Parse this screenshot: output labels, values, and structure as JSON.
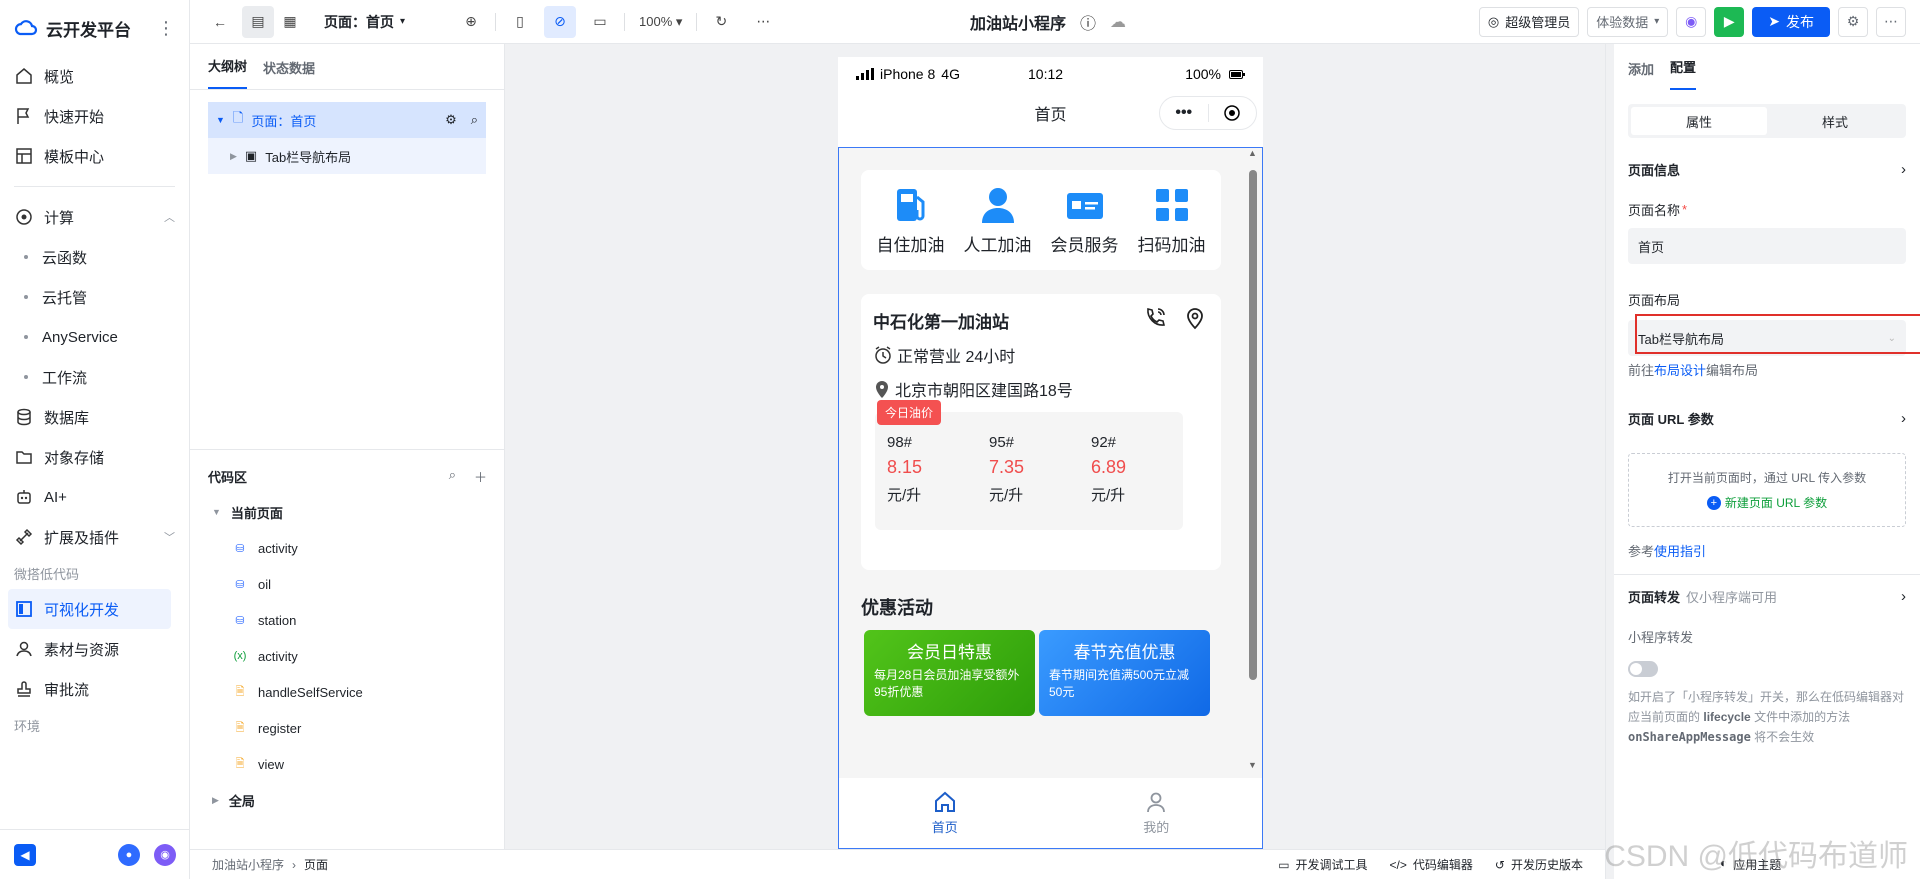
{
  "brand": {
    "name": "云开发平台"
  },
  "nav": {
    "overview": "概览",
    "quickstart": "快速开始",
    "templates": "模板中心",
    "compute": "计算",
    "functions": "云函数",
    "hosting": "云托管",
    "anyservice": "AnyService",
    "workflow": "工作流",
    "database": "数据库",
    "storage": "对象存储",
    "ai": "AI+",
    "extensions": "扩展及插件",
    "lowcode_group": "微搭低代码",
    "visual_dev": "可视化开发",
    "assets": "素材与资源",
    "approval": "审批流",
    "env_group": "环境"
  },
  "toolbar": {
    "page_selector": "页面：首页",
    "zoom": "100%",
    "app_title": "加油站小程序",
    "admin": "超级管理员",
    "data_mode": "体验数据",
    "publish": "发布"
  },
  "outline": {
    "tab_tree": "大纲树",
    "tab_state": "状态数据",
    "page_node": "页面：首页",
    "child_node": "Tab栏导航布局"
  },
  "code": {
    "title": "代码区",
    "current_page": "当前页面",
    "items": [
      "activity",
      "oil",
      "station",
      "activity",
      "handleSelfService",
      "register",
      "view"
    ],
    "global": "全局"
  },
  "phone": {
    "carrier": "iPhone 8",
    "network": "4G",
    "time": "10:12",
    "battery": "100%",
    "nav_title": "首页",
    "services": [
      "自住加油",
      "人工加油",
      "会员服务",
      "扫码加油"
    ],
    "station_name": "中石化第一加油站",
    "hours": "正常营业 24小时",
    "address": "北京市朝阳区建国路18号",
    "price_tag": "今日油价",
    "fuels": [
      {
        "grade": "98#",
        "price": "8.15",
        "unit": "元/升"
      },
      {
        "grade": "95#",
        "price": "7.35",
        "unit": "元/升"
      },
      {
        "grade": "92#",
        "price": "6.89",
        "unit": "元/升"
      }
    ],
    "promo_title": "优惠活动",
    "promos": [
      {
        "title": "会员日特惠",
        "desc": "每月28日会员加油享受额外95折优惠"
      },
      {
        "title": "春节充值优惠",
        "desc": "春节期间充值满500元立减50元"
      }
    ],
    "tabbar": [
      "首页",
      "我的"
    ]
  },
  "config": {
    "tab_add": "添加",
    "tab_config": "配置",
    "seg_props": "属性",
    "seg_style": "样式",
    "page_info": "页面信息",
    "page_name_label": "页面名称",
    "page_name_value": "首页",
    "layout_label": "页面布局",
    "layout_value": "Tab栏导航布局",
    "layout_link_pre": "前往",
    "layout_link": "布局设计",
    "layout_link_post": "编辑布局",
    "url_params": "页面 URL 参数",
    "url_hint": "打开当前页面时，通过 URL 传入参数",
    "url_add": "新建页面 URL 参数",
    "guide_pre": "参考",
    "guide_link": "使用指引",
    "forward_title": "页面转发",
    "forward_sub": "仅小程序端可用",
    "mp_forward": "小程序转发",
    "note_1": "如开启了「小程序转发」开关，那么在低码编辑器对应当前页面的",
    "note_code1": "lifecycle",
    "note_2": "文件中添加的方法",
    "note_code2": "onShareAppMessage",
    "note_3": "将不会生效"
  },
  "bottombar": {
    "crumb_app": "加油站小程序",
    "crumb_page": "页面",
    "debug": "开发调试工具",
    "code_editor": "代码编辑器",
    "history": "开发历史版本",
    "theme": "应用主题"
  },
  "watermark": "CSDN @低代码布道师",
  "colors": {
    "accent": "#0a5cf5",
    "price": "#f04d4d",
    "highlight": "#e0302a"
  }
}
